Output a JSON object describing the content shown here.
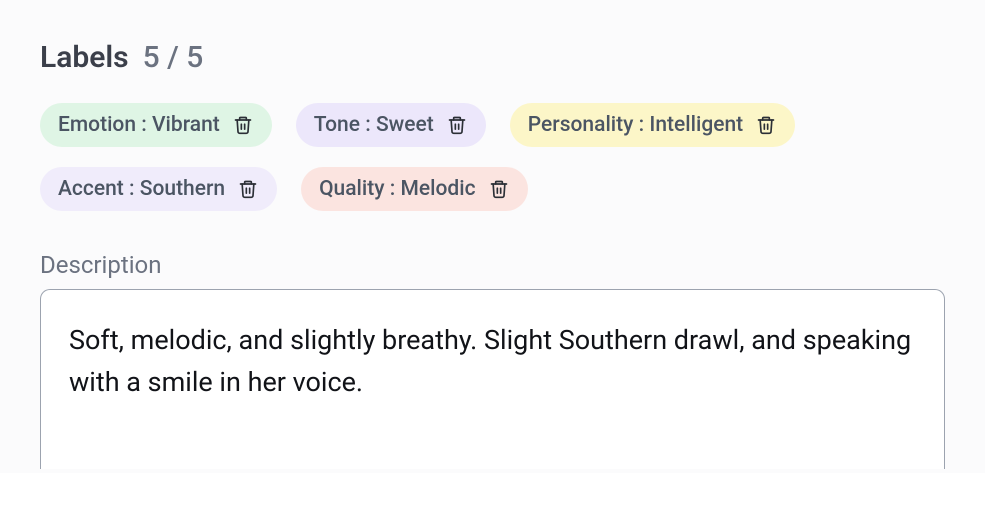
{
  "header": {
    "title": "Labels",
    "count": "5 / 5"
  },
  "labels": [
    {
      "category": "Emotion",
      "value": "Vibrant",
      "color": "green"
    },
    {
      "category": "Tone",
      "value": "Sweet",
      "color": "purple"
    },
    {
      "category": "Personality",
      "value": "Intelligent",
      "color": "yellow"
    },
    {
      "category": "Accent",
      "value": "Southern",
      "color": "lavender"
    },
    {
      "category": "Quality",
      "value": "Melodic",
      "color": "pink"
    }
  ],
  "description": {
    "label": "Description",
    "value": "Soft, melodic, and slightly breathy. Slight Southern drawl, and speaking with a smile in her voice."
  }
}
